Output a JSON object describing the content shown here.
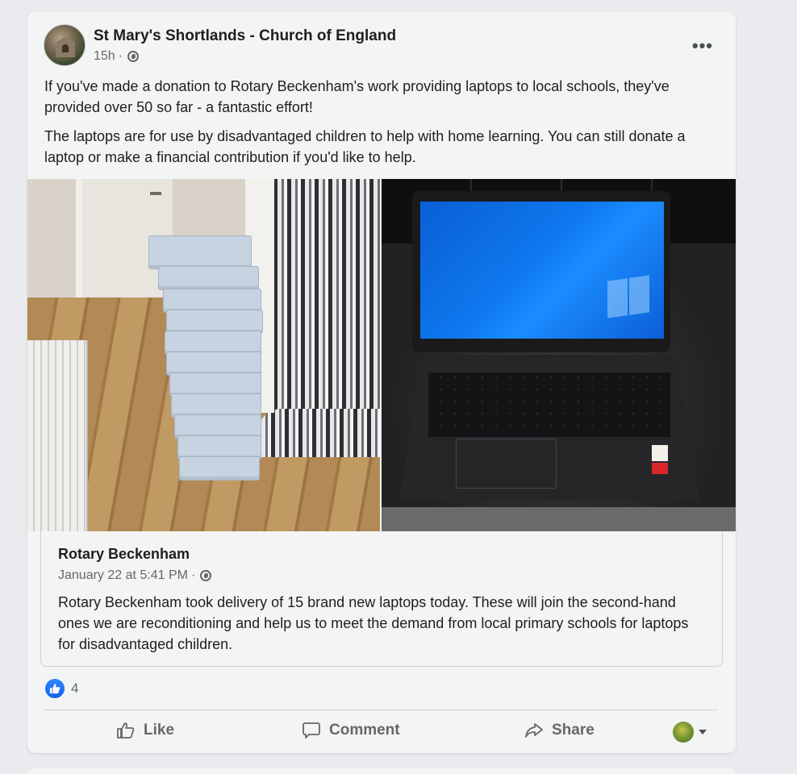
{
  "post": {
    "page_name": "St Mary's Shortlands - Church of England",
    "time": "15h",
    "separator": "·",
    "paragraphs": [
      "If you've made a donation to Rotary Beckenham's work providing laptops to local schools, they've provided over 50 so far - a fantastic effort!",
      "The laptops are for use by disadvantaged children to help with home learning. You can still donate a laptop or make a financial contribution if you'd like to help."
    ],
    "more_icon": "•••"
  },
  "shared": {
    "name": "Rotary Beckenham",
    "date": "January 22 at 5:41 PM",
    "separator": "·",
    "text": "Rotary Beckenham took delivery of 15 brand new laptops today.  These will join the second-hand ones we are reconditioning and help us to meet the demand from local primary schools for laptops for disadvantaged children."
  },
  "reactions": {
    "icon": "like-reaction-icon",
    "count": "4"
  },
  "actions": {
    "like": "Like",
    "comment": "Comment",
    "share": "Share"
  },
  "colors": {
    "like_blue": "#1877f2",
    "card_bg": "#f3f5f4",
    "muted_text": "#65676b"
  }
}
